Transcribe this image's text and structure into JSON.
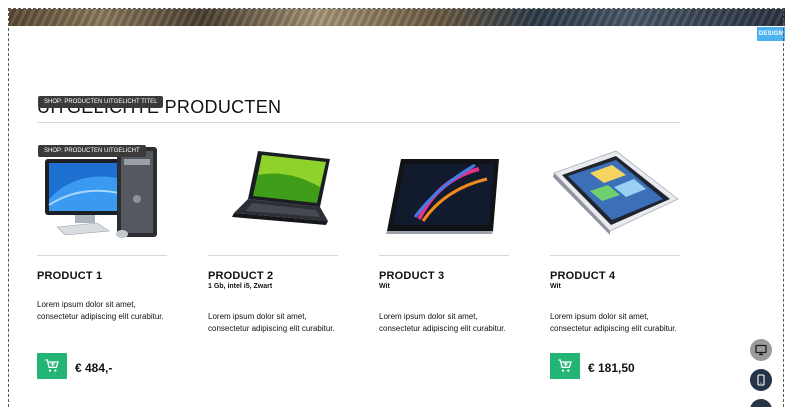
{
  "builder": {
    "design_button": "DESIGN",
    "edit_tags": {
      "title_tag": "SHOP: PRODUCTEN UITGELICHT TITEL",
      "products_tag": "SHOP: PRODUCTEN UITGELICHT"
    }
  },
  "section": {
    "title": "UITGELICHTE PRODUCTEN"
  },
  "products": [
    {
      "name": "PRODUCT 1",
      "subtitle": "",
      "description": "Lorem ipsum dolor sit amet, consectetur adipiscing elit curabitur.",
      "price": "€ 484,-",
      "image_icon": "desktop-computer-image"
    },
    {
      "name": "PRODUCT 2",
      "subtitle": "1 Gb, intel i5, Zwart",
      "description": "Lorem ipsum dolor sit amet, consectetur adipiscing elit curabitur.",
      "price": "",
      "image_icon": "laptop-image"
    },
    {
      "name": "PRODUCT 3",
      "subtitle": "Wit",
      "description": "Lorem ipsum dolor sit amet, consectetur adipiscing elit curabitur.",
      "price": "",
      "image_icon": "tablet-image"
    },
    {
      "name": "PRODUCT 4",
      "subtitle": "Wit",
      "description": "Lorem ipsum dolor sit amet, consectetur adipiscing elit curabitur.",
      "price": "€ 181,50",
      "image_icon": "tablet-angled-image"
    }
  ],
  "colors": {
    "cart_button": "#22b573",
    "design_button": "#4db3f0",
    "edit_tag": "#3a3a3a",
    "side_button_dark": "#253446",
    "side_button_light": "#9a9a9a"
  },
  "side_controls": [
    "desktop-view-icon",
    "mobile-view-icon",
    "more-icon"
  ]
}
